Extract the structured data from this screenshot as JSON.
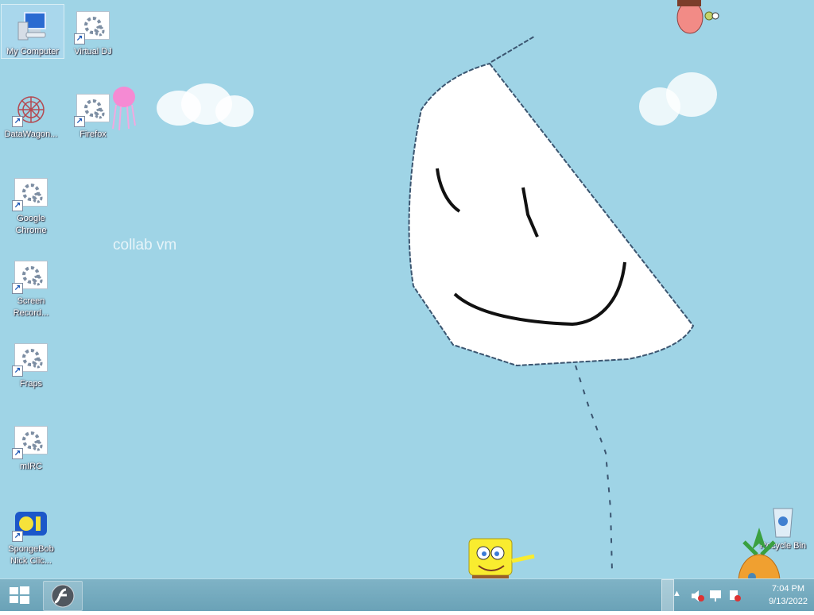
{
  "desktop": {
    "watermark": "collab vm",
    "icons": [
      {
        "label": "My Computer"
      },
      {
        "label": "Virtual DJ"
      },
      {
        "label": "DataWagon..."
      },
      {
        "label": "Firefox"
      },
      {
        "label": "Google Chrome"
      },
      {
        "label": "Screen Record..."
      },
      {
        "label": "Fraps"
      },
      {
        "label": "mIRC"
      },
      {
        "label": "SpongeBob Nick Clic..."
      },
      {
        "label": "Recycle Bin"
      }
    ]
  },
  "taskbar": {
    "start_icon": "windows-logo-icon",
    "pinned_app_icon": "flash-icon",
    "tray": {
      "clock_time": "7:04 PM",
      "clock_date": "9/13/2022"
    }
  },
  "colors": {
    "desktop_bg": "#9fd4e6",
    "taskbar_bg": "#6aa2b7"
  }
}
